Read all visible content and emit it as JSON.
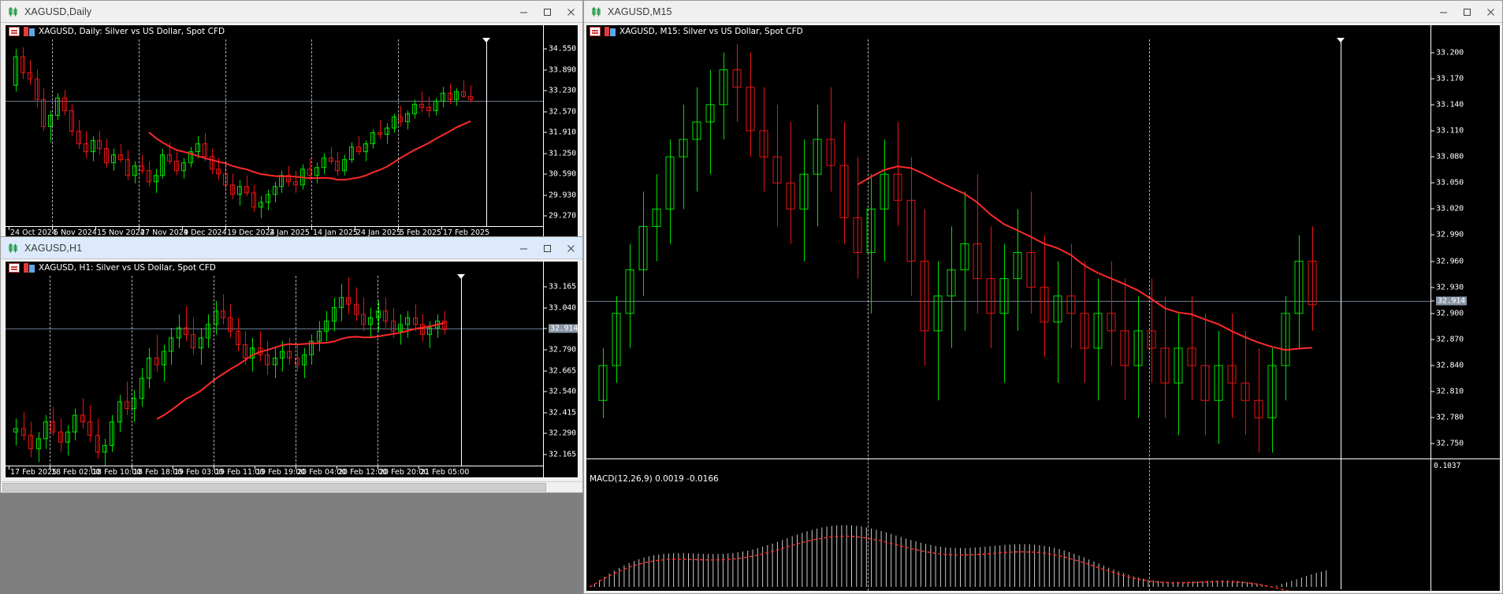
{
  "app": {
    "background_color": "#7f7f7f"
  },
  "windows": [
    {
      "id": "daily",
      "title": "XAGUSD,Daily",
      "active": false,
      "icon": "candlestick-icon",
      "buttons": {
        "minimize": "Minimize",
        "maximize": "Maximize",
        "close": "Close"
      },
      "chart_header": "XAGUSD, Daily:  Silver vs US Dollar, Spot CFD"
    },
    {
      "id": "h1",
      "title": "XAGUSD,H1",
      "active": true,
      "icon": "candlestick-icon",
      "buttons": {
        "minimize": "Minimize",
        "maximize": "Maximize",
        "close": "Close"
      },
      "chart_header": "XAGUSD, H1:  Silver vs US Dollar, Spot CFD"
    },
    {
      "id": "m15",
      "title": "XAGUSD,M15",
      "active": false,
      "icon": "candlestick-icon",
      "buttons": {
        "minimize": "Minimize",
        "maximize": "Maximize",
        "close": "Close"
      },
      "chart_header": "XAGUSD, M15:  Silver vs US Dollar, Spot CFD",
      "indicator_label": "MACD(12,26,9) 0.0019 -0.0166",
      "indicator_scale_top": "0.1037"
    }
  ],
  "chart_data": [
    {
      "id": "daily",
      "type": "candlestick",
      "title": "XAGUSD, Daily:  Silver vs US Dollar, Spot CFD",
      "symbol": "XAGUSD",
      "timeframe": "Daily",
      "description": "Silver vs US Dollar, Spot CFD",
      "current_price": "32.914",
      "ylabel": "",
      "xlabel": "",
      "grid": true,
      "legend": "none",
      "ylim": [
        28.95,
        34.85
      ],
      "yticks": [
        "34.550",
        "33.890",
        "33.230",
        "32.570",
        "31.910",
        "31.250",
        "30.590",
        "29.930",
        "29.270"
      ],
      "xticks": [
        "24 Oct 2024",
        "5 Nov 2024",
        "15 Nov 2024",
        "27 Nov 2024",
        "9 Dec 2024",
        "19 Dec 2024",
        "2 Jan 2025",
        "14 Jan 2025",
        "24 Jan 2025",
        "5 Feb 2025",
        "17 Feb 2025"
      ],
      "overlays": [
        {
          "name": "Moving Average",
          "color": "#ff2a2a"
        }
      ],
      "ohlc": [
        [
          33.4,
          34.55,
          33.2,
          34.3
        ],
        [
          34.3,
          34.6,
          33.6,
          33.8
        ],
        [
          33.8,
          34.2,
          33.4,
          33.6
        ],
        [
          33.6,
          33.9,
          32.7,
          32.95
        ],
        [
          32.95,
          33.3,
          31.95,
          32.1
        ],
        [
          32.1,
          32.6,
          31.6,
          32.45
        ],
        [
          32.45,
          33.15,
          32.3,
          33.0
        ],
        [
          33.0,
          33.25,
          32.45,
          32.6
        ],
        [
          32.6,
          32.8,
          31.8,
          31.95
        ],
        [
          31.95,
          32.3,
          31.4,
          31.55
        ],
        [
          31.55,
          31.95,
          31.1,
          31.3
        ],
        [
          31.3,
          31.8,
          31.0,
          31.65
        ],
        [
          31.65,
          31.95,
          31.2,
          31.4
        ],
        [
          31.4,
          31.7,
          30.8,
          30.95
        ],
        [
          30.95,
          31.4,
          30.7,
          31.2
        ],
        [
          31.2,
          31.55,
          30.95,
          31.05
        ],
        [
          31.05,
          31.35,
          30.4,
          30.55
        ],
        [
          30.55,
          31.0,
          30.3,
          30.85
        ],
        [
          30.85,
          31.2,
          30.6,
          30.7
        ],
        [
          30.7,
          31.0,
          30.2,
          30.35
        ],
        [
          30.35,
          30.75,
          30.0,
          30.55
        ],
        [
          30.55,
          31.4,
          30.45,
          31.2
        ],
        [
          31.2,
          31.6,
          30.9,
          31.0
        ],
        [
          31.0,
          31.3,
          30.55,
          30.7
        ],
        [
          30.7,
          31.1,
          30.45,
          30.95
        ],
        [
          30.95,
          31.45,
          30.8,
          31.3
        ],
        [
          31.3,
          31.8,
          31.1,
          31.55
        ],
        [
          31.55,
          31.9,
          31.0,
          31.15
        ],
        [
          31.15,
          31.4,
          30.6,
          30.75
        ],
        [
          30.75,
          31.1,
          30.4,
          30.6
        ],
        [
          30.6,
          30.95,
          30.1,
          30.25
        ],
        [
          30.25,
          30.6,
          29.8,
          29.95
        ],
        [
          29.95,
          30.4,
          29.6,
          30.2
        ],
        [
          30.2,
          30.55,
          29.9,
          30.0
        ],
        [
          30.0,
          30.25,
          29.4,
          29.55
        ],
        [
          29.55,
          29.9,
          29.2,
          29.7
        ],
        [
          29.7,
          30.1,
          29.45,
          29.95
        ],
        [
          29.95,
          30.35,
          29.7,
          30.2
        ],
        [
          30.2,
          30.7,
          30.0,
          30.55
        ],
        [
          30.55,
          30.85,
          30.2,
          30.35
        ],
        [
          30.35,
          30.7,
          30.0,
          30.25
        ],
        [
          30.25,
          30.9,
          30.1,
          30.75
        ],
        [
          30.75,
          31.1,
          30.4,
          30.55
        ],
        [
          30.55,
          30.95,
          30.3,
          30.8
        ],
        [
          30.8,
          31.25,
          30.6,
          31.1
        ],
        [
          31.1,
          31.45,
          30.9,
          31.0
        ],
        [
          31.0,
          31.3,
          30.55,
          30.7
        ],
        [
          30.7,
          31.2,
          30.55,
          31.05
        ],
        [
          31.05,
          31.6,
          30.95,
          31.45
        ],
        [
          31.45,
          31.8,
          31.2,
          31.3
        ],
        [
          31.3,
          31.65,
          31.0,
          31.55
        ],
        [
          31.55,
          32.0,
          31.4,
          31.9
        ],
        [
          31.9,
          32.3,
          31.7,
          31.85
        ],
        [
          31.85,
          32.2,
          31.55,
          32.05
        ],
        [
          32.05,
          32.5,
          31.9,
          32.4
        ],
        [
          32.4,
          32.75,
          32.1,
          32.25
        ],
        [
          32.25,
          32.6,
          32.0,
          32.5
        ],
        [
          32.5,
          32.95,
          32.35,
          32.8
        ],
        [
          32.8,
          33.2,
          32.55,
          32.7
        ],
        [
          32.7,
          33.05,
          32.4,
          32.6
        ],
        [
          32.6,
          33.0,
          32.45,
          32.9
        ],
        [
          32.9,
          33.35,
          32.7,
          33.15
        ],
        [
          33.15,
          33.45,
          32.8,
          32.95
        ],
        [
          32.95,
          33.3,
          32.75,
          33.2
        ],
        [
          33.2,
          33.55,
          33.0,
          33.05
        ],
        [
          33.05,
          33.4,
          32.85,
          32.95
        ]
      ]
    },
    {
      "id": "h1",
      "type": "candlestick",
      "title": "XAGUSD, H1:  Silver vs US Dollar, Spot CFD",
      "symbol": "XAGUSD",
      "timeframe": "H1",
      "description": "Silver vs US Dollar, Spot CFD",
      "current_price": "32.914",
      "ylabel": "",
      "xlabel": "",
      "grid": true,
      "legend": "none",
      "ylim": [
        32.1,
        33.23
      ],
      "yticks": [
        "33.165",
        "33.040",
        "32.914",
        "32.790",
        "32.665",
        "32.540",
        "32.415",
        "32.290",
        "32.165"
      ],
      "xticks": [
        "17 Feb 2025",
        "18 Feb 02:00",
        "18 Feb 10:00",
        "18 Feb 18:00",
        "19 Feb 03:00",
        "19 Feb 11:00",
        "19 Feb 19:00",
        "20 Feb 04:00",
        "20 Feb 12:00",
        "20 Feb 20:00",
        "21 Feb 05:00"
      ],
      "overlays": [
        {
          "name": "Moving Average",
          "color": "#ff2a2a"
        }
      ],
      "ohlc": [
        [
          32.3,
          32.38,
          32.22,
          32.32
        ],
        [
          32.32,
          32.42,
          32.25,
          32.28
        ],
        [
          32.28,
          32.36,
          32.15,
          32.2
        ],
        [
          32.2,
          32.3,
          32.12,
          32.26
        ],
        [
          32.26,
          32.4,
          32.2,
          32.36
        ],
        [
          32.36,
          32.45,
          32.28,
          32.3
        ],
        [
          32.3,
          32.38,
          32.18,
          32.24
        ],
        [
          32.24,
          32.34,
          32.16,
          32.3
        ],
        [
          32.3,
          32.44,
          32.25,
          32.4
        ],
        [
          32.4,
          32.5,
          32.32,
          32.36
        ],
        [
          32.36,
          32.46,
          32.24,
          32.28
        ],
        [
          32.28,
          32.38,
          32.14,
          32.18
        ],
        [
          32.18,
          32.26,
          32.1,
          32.22
        ],
        [
          32.22,
          32.4,
          32.18,
          32.36
        ],
        [
          32.36,
          32.52,
          32.3,
          32.48
        ],
        [
          32.48,
          32.6,
          32.4,
          32.44
        ],
        [
          32.44,
          32.55,
          32.36,
          32.5
        ],
        [
          32.5,
          32.68,
          32.45,
          32.62
        ],
        [
          32.62,
          32.8,
          32.56,
          32.74
        ],
        [
          32.74,
          32.88,
          32.66,
          32.7
        ],
        [
          32.7,
          32.82,
          32.6,
          32.78
        ],
        [
          32.78,
          32.92,
          32.7,
          32.86
        ],
        [
          32.86,
          33.0,
          32.8,
          32.92
        ],
        [
          32.92,
          33.05,
          32.84,
          32.88
        ],
        [
          32.88,
          32.98,
          32.76,
          32.8
        ],
        [
          32.8,
          32.92,
          32.7,
          32.86
        ],
        [
          32.86,
          33.0,
          32.8,
          32.94
        ],
        [
          32.94,
          33.08,
          32.88,
          33.02
        ],
        [
          33.02,
          33.12,
          32.94,
          32.98
        ],
        [
          32.98,
          33.06,
          32.86,
          32.9
        ],
        [
          32.9,
          32.98,
          32.78,
          32.82
        ],
        [
          32.82,
          32.9,
          32.7,
          32.74
        ],
        [
          32.74,
          32.86,
          32.66,
          32.8
        ],
        [
          32.8,
          32.9,
          32.72,
          32.76
        ],
        [
          32.76,
          32.84,
          32.64,
          32.7
        ],
        [
          32.7,
          32.8,
          32.62,
          32.74
        ],
        [
          32.74,
          32.84,
          32.66,
          32.78
        ],
        [
          32.78,
          32.86,
          32.7,
          32.74
        ],
        [
          32.74,
          32.82,
          32.66,
          32.7
        ],
        [
          32.7,
          32.8,
          32.62,
          32.76
        ],
        [
          32.76,
          32.88,
          32.7,
          32.84
        ],
        [
          32.84,
          32.96,
          32.78,
          32.9
        ],
        [
          32.9,
          33.02,
          32.84,
          32.96
        ],
        [
          32.96,
          33.1,
          32.9,
          33.04
        ],
        [
          33.04,
          33.18,
          32.96,
          33.1
        ],
        [
          33.1,
          33.22,
          33.0,
          33.06
        ],
        [
          33.06,
          33.16,
          32.96,
          33.0
        ],
        [
          33.0,
          33.1,
          32.9,
          32.94
        ],
        [
          32.94,
          33.04,
          32.86,
          32.98
        ],
        [
          32.98,
          33.08,
          32.9,
          33.02
        ],
        [
          33.02,
          33.1,
          32.92,
          32.96
        ],
        [
          32.96,
          33.04,
          32.86,
          32.9
        ],
        [
          32.9,
          33.0,
          32.82,
          32.94
        ],
        [
          32.94,
          33.02,
          32.86,
          32.98
        ],
        [
          32.98,
          33.06,
          32.9,
          32.94
        ],
        [
          32.94,
          33.0,
          32.84,
          32.88
        ],
        [
          32.88,
          32.96,
          32.8,
          32.92
        ],
        [
          32.92,
          33.0,
          32.86,
          32.96
        ],
        [
          32.96,
          33.02,
          32.88,
          32.91
        ]
      ]
    },
    {
      "id": "m15",
      "type": "candlestick",
      "title": "XAGUSD, M15:  Silver vs US Dollar, Spot CFD",
      "symbol": "XAGUSD",
      "timeframe": "M15",
      "description": "Silver vs US Dollar, Spot CFD",
      "current_price": "32.914",
      "ylabel": "",
      "xlabel": "",
      "grid": true,
      "legend": "none",
      "ylim": [
        32.735,
        33.215
      ],
      "yticks": [
        "33.200",
        "33.170",
        "33.140",
        "33.110",
        "33.080",
        "33.050",
        "33.020",
        "32.990",
        "32.960",
        "32.930",
        "32.914",
        "32.900",
        "32.870",
        "32.840",
        "32.810",
        "32.780",
        "32.750"
      ],
      "xticks": [],
      "overlays": [
        {
          "name": "Moving Average",
          "color": "#ff2a2a"
        }
      ],
      "subchart": {
        "type": "histogram",
        "name": "MACD",
        "label": "MACD(12,26,9) 0.0019 -0.0166",
        "params": [
          12,
          26,
          9
        ],
        "macd_value": 0.0019,
        "signal_value": -0.0166,
        "scale_top": "0.1037"
      },
      "ohlc": [
        [
          32.8,
          32.86,
          32.78,
          32.84
        ],
        [
          32.84,
          32.92,
          32.82,
          32.9
        ],
        [
          32.9,
          32.98,
          32.86,
          32.95
        ],
        [
          32.95,
          33.04,
          32.92,
          33.0
        ],
        [
          33.0,
          33.06,
          32.96,
          33.02
        ],
        [
          33.02,
          33.1,
          32.98,
          33.08
        ],
        [
          33.08,
          33.14,
          33.02,
          33.1
        ],
        [
          33.1,
          33.16,
          33.04,
          33.12
        ],
        [
          33.12,
          33.18,
          33.06,
          33.14
        ],
        [
          33.14,
          33.2,
          33.1,
          33.18
        ],
        [
          33.18,
          33.21,
          33.12,
          33.16
        ],
        [
          33.16,
          33.2,
          33.08,
          33.11
        ],
        [
          33.11,
          33.16,
          33.04,
          33.08
        ],
        [
          33.08,
          33.14,
          33.0,
          33.05
        ],
        [
          33.05,
          33.12,
          32.98,
          33.02
        ],
        [
          33.02,
          33.1,
          32.96,
          33.06
        ],
        [
          33.06,
          33.14,
          33.0,
          33.1
        ],
        [
          33.1,
          33.16,
          33.04,
          33.07
        ],
        [
          33.07,
          33.12,
          32.98,
          33.01
        ],
        [
          33.01,
          33.08,
          32.94,
          32.97
        ],
        [
          32.97,
          33.06,
          32.9,
          33.02
        ],
        [
          33.02,
          33.1,
          32.96,
          33.06
        ],
        [
          33.06,
          33.12,
          33.0,
          33.03
        ],
        [
          33.03,
          33.08,
          32.92,
          32.96
        ],
        [
          32.96,
          33.02,
          32.84,
          32.88
        ],
        [
          32.88,
          32.96,
          32.8,
          32.92
        ],
        [
          32.92,
          33.0,
          32.86,
          32.95
        ],
        [
          32.95,
          33.04,
          32.88,
          32.98
        ],
        [
          32.98,
          33.06,
          32.9,
          32.94
        ],
        [
          32.94,
          33.0,
          32.86,
          32.9
        ],
        [
          32.9,
          32.98,
          32.82,
          32.94
        ],
        [
          32.94,
          33.02,
          32.88,
          32.97
        ],
        [
          32.97,
          33.04,
          32.9,
          32.93
        ],
        [
          32.93,
          32.99,
          32.85,
          32.89
        ],
        [
          32.89,
          32.96,
          32.82,
          32.92
        ],
        [
          32.92,
          32.98,
          32.86,
          32.9
        ],
        [
          32.9,
          32.96,
          32.82,
          32.86
        ],
        [
          32.86,
          32.94,
          32.8,
          32.9
        ],
        [
          32.9,
          32.96,
          32.84,
          32.88
        ],
        [
          32.88,
          32.94,
          32.8,
          32.84
        ],
        [
          32.84,
          32.92,
          32.78,
          32.88
        ],
        [
          32.88,
          32.94,
          32.82,
          32.86
        ],
        [
          32.86,
          32.92,
          32.78,
          32.82
        ],
        [
          32.82,
          32.9,
          32.76,
          32.86
        ],
        [
          32.86,
          32.92,
          32.8,
          32.84
        ],
        [
          32.84,
          32.9,
          32.76,
          32.8
        ],
        [
          32.8,
          32.88,
          32.75,
          32.84
        ],
        [
          32.84,
          32.9,
          32.78,
          32.82
        ],
        [
          32.82,
          32.88,
          32.76,
          32.8
        ],
        [
          32.8,
          32.86,
          32.74,
          32.78
        ],
        [
          32.78,
          32.86,
          32.74,
          32.84
        ],
        [
          32.84,
          32.92,
          32.8,
          32.9
        ],
        [
          32.9,
          32.99,
          32.86,
          32.96
        ],
        [
          32.96,
          33.0,
          32.88,
          32.91
        ]
      ]
    }
  ]
}
